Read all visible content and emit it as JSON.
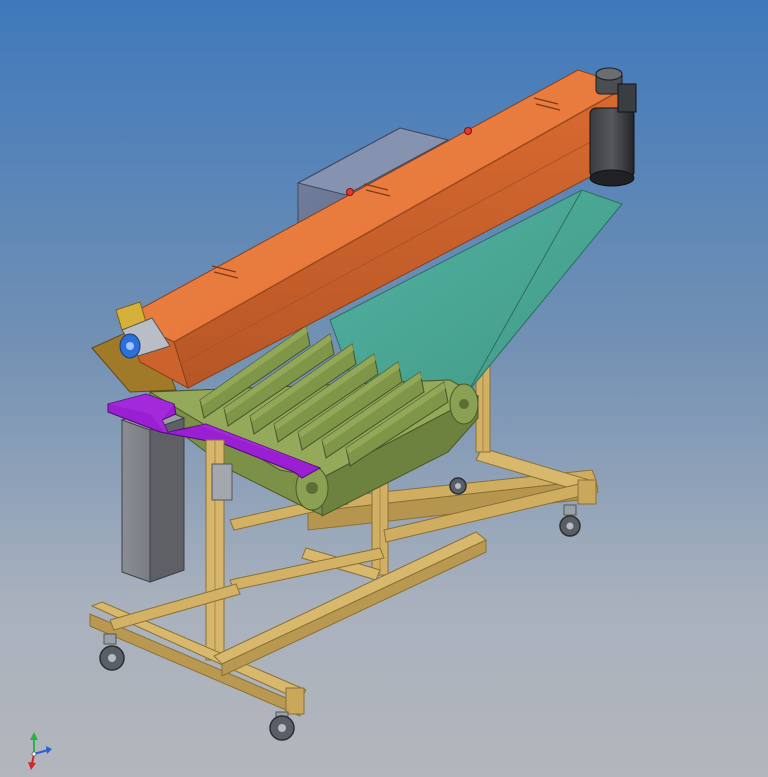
{
  "colors": {
    "background_top": "#3f79bb",
    "background_bottom": "#b3b6bc",
    "housing_orange": "#e8763a",
    "housing_orange_dark": "#c85f2a",
    "chute_teal": "#4aa896",
    "conveyor_olive": "#7a8f45",
    "conveyor_olive_light": "#92a657",
    "plate_purple": "#9a1fd2",
    "bin_gray": "#7b7e86",
    "gearbox_slate": "#6a7692",
    "frame_tan": "#d4b46a",
    "frame_tan_dark": "#a88a45",
    "motor_dark": "#2b2d30",
    "motor_blue": "#2d6fd6",
    "bracket_yellow": "#d6b13a"
  },
  "icons": {
    "view_triad": "axis-triad-icon",
    "caster": "caster-wheel-icon",
    "motor": "drive-motor-icon"
  }
}
